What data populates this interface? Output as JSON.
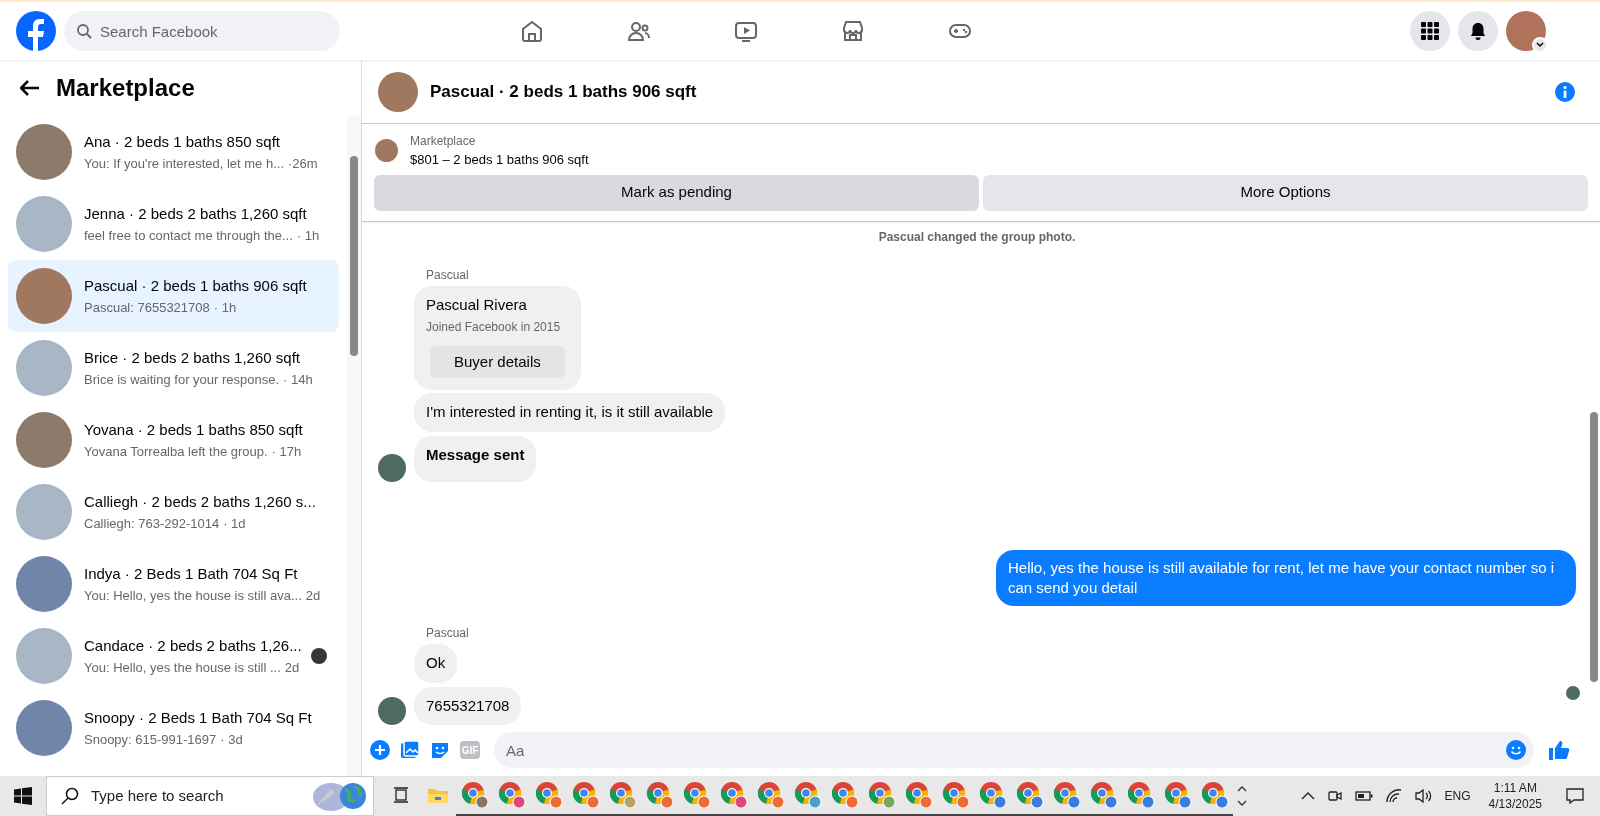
{
  "top_bar": {
    "search": {
      "placeholder": "Search Facebook"
    }
  },
  "sidebar": {
    "title": "Marketplace",
    "conversations": [
      {
        "title": "Ana · 2 beds 1 baths 850 sqft",
        "preview": "You: If you're interested, let me h...",
        "time": "·26m",
        "selected": false,
        "seen": false
      },
      {
        "title": "Jenna · 2 beds 2 baths 1,260 sqft",
        "preview": "feel free to contact me through the...",
        "time": "· 1h",
        "selected": false,
        "seen": false
      },
      {
        "title": "Pascual · 2 beds 1 baths 906 sqft",
        "preview": "Pascual: 7655321708",
        "time": "· 1h",
        "selected": true,
        "seen": false
      },
      {
        "title": "Brice · 2 beds 2 baths 1,260 sqft",
        "preview": "Brice is waiting for your response.",
        "time": "· 14h",
        "selected": false,
        "seen": false
      },
      {
        "title": "Yovana · 2 beds 1 baths 850 sqft",
        "preview": "Yovana Torrealba left the group.",
        "time": "· 17h",
        "selected": false,
        "seen": false
      },
      {
        "title": "Calliegh · 2 beds 2 baths 1,260 s...",
        "preview": "Calliegh: 763-292-1014",
        "time": "· 1d",
        "selected": false,
        "seen": false
      },
      {
        "title": "Indya · 2 Beds 1 Bath 704 Sq Ft",
        "preview": "You: Hello, yes the house is still ava...",
        "time": "2d",
        "selected": false,
        "seen": false
      },
      {
        "title": "Candace · 2 beds 2 baths 1,26...",
        "preview": "You: Hello, yes the house is still ...",
        "time": "2d",
        "selected": false,
        "seen": true
      },
      {
        "title": "Snoopy · 2 Beds 1 Bath 704 Sq Ft",
        "preview": "Snoopy: 615-991-1697",
        "time": "· 3d",
        "selected": false,
        "seen": false
      }
    ]
  },
  "chat": {
    "title": "Pascual · 2 beds 1 baths 906 sqft",
    "listing": {
      "label": "Marketplace",
      "summary": "$801 – 2 beds 1 baths 906 sqft",
      "buttons": [
        "Mark as pending",
        "More Options"
      ]
    },
    "messages": [
      {
        "kind": "system",
        "text": "Pascual changed the group photo."
      },
      {
        "kind": "sender",
        "text": "Pascual"
      },
      {
        "kind": "card",
        "name": "Pascual Rivera",
        "detail": "Joined Facebook in 2015",
        "button": "Buyer details"
      },
      {
        "kind": "incoming",
        "text": "I'm interested in renting it, is it still available",
        "avatar": false
      },
      {
        "kind": "incoming",
        "text": "Message sent",
        "avatar": true,
        "bold": true
      },
      {
        "kind": "outgoing",
        "text": "Hello, yes the house is still available for rent, let me have your contact number so i can send you detail"
      },
      {
        "kind": "sender",
        "text": "Pascual"
      },
      {
        "kind": "incoming",
        "text": "Ok",
        "avatar": false
      },
      {
        "kind": "incoming",
        "text": "7655321708",
        "avatar": true
      }
    ],
    "composer": {
      "placeholder": "Aa",
      "gif_label": "GIF"
    }
  },
  "taskbar": {
    "search_placeholder": "Type here to search",
    "apps": [
      {
        "kind": "taskview"
      },
      {
        "kind": "folder"
      },
      {
        "kind": "chrome",
        "color": "#8a7560"
      },
      {
        "kind": "chrome",
        "color": "#e0457b"
      },
      {
        "kind": "chrome",
        "color": "#f06a35"
      },
      {
        "kind": "chrome",
        "color": "#f06a35"
      },
      {
        "kind": "chrome",
        "color": "#b5a36a"
      },
      {
        "kind": "chrome",
        "color": "#f06a35"
      },
      {
        "kind": "chrome",
        "color": "#f06a35"
      },
      {
        "kind": "chrome",
        "color": "#e0457b"
      },
      {
        "kind": "chrome",
        "color": "#f06a35"
      },
      {
        "kind": "chrome",
        "color": "#4aa3c7"
      },
      {
        "kind": "chrome",
        "color": "#f06a35"
      },
      {
        "kind": "chrome",
        "color": "#7aa85a"
      },
      {
        "kind": "chrome",
        "color": "#f06a35"
      },
      {
        "kind": "chrome",
        "color": "#f06a35"
      },
      {
        "kind": "chrome",
        "color": "#3b7ddd"
      },
      {
        "kind": "chrome",
        "color": "#3b7ddd"
      },
      {
        "kind": "chrome",
        "color": "#3b7ddd"
      },
      {
        "kind": "chrome",
        "color": "#3b7ddd"
      },
      {
        "kind": "chrome",
        "color": "#3b7ddd"
      },
      {
        "kind": "chrome",
        "color": "#3b7ddd"
      },
      {
        "kind": "chrome",
        "color": "#3b7ddd"
      }
    ],
    "language": "ENG",
    "time": "1:11 AM",
    "date": "4/13/2025"
  }
}
